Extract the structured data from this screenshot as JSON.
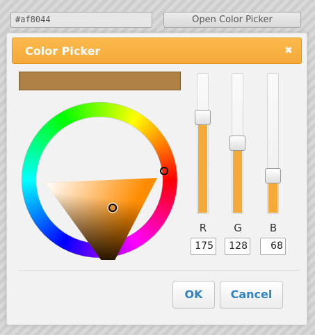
{
  "hex_field": {
    "value": "#af8044"
  },
  "open_button": {
    "label": "Open Color Picker"
  },
  "dialog": {
    "title": "Color Picker",
    "close_glyph": "✖",
    "close_icon": "close-icon",
    "current_color": "#af8044",
    "accent_color": "#f5a939",
    "hue_selector_color": "#ff8c00",
    "channels": [
      {
        "label": "R",
        "value": "175",
        "level": 0.686
      },
      {
        "label": "G",
        "value": "128",
        "level": 0.502
      },
      {
        "label": "B",
        "value": "68",
        "level": 0.267
      }
    ],
    "ok_label": "OK",
    "cancel_label": "Cancel"
  }
}
